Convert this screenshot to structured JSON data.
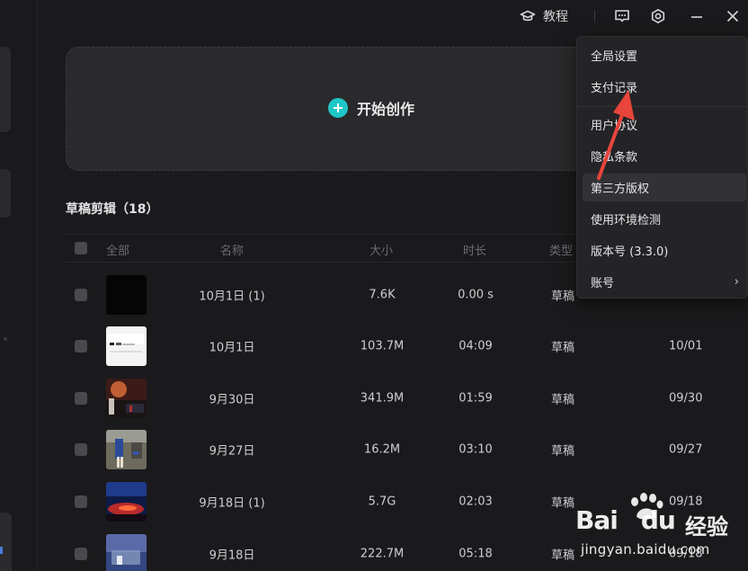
{
  "topbar": {
    "tutorial_label": "教程",
    "icons": [
      "graduation-cap-icon",
      "feedback-icon",
      "settings-hexagon-icon",
      "minimize-icon",
      "close-icon"
    ]
  },
  "create": {
    "label": "开始创作",
    "accent": "#1fc6c6"
  },
  "drafts": {
    "title": "草稿剪辑（18）",
    "columns": {
      "select_all": "全部",
      "name": "名称",
      "size": "大小",
      "duration": "时长",
      "type": "类型"
    },
    "rows": [
      {
        "name": "10月1日 (1)",
        "size": "7.6K",
        "duration": "0.00 s",
        "type": "草稿",
        "date": ""
      },
      {
        "name": "10月1日",
        "size": "103.7M",
        "duration": "04:09",
        "type": "草稿",
        "date": "10/01"
      },
      {
        "name": "9月30日",
        "size": "341.9M",
        "duration": "01:59",
        "type": "草稿",
        "date": "09/30"
      },
      {
        "name": "9月27日",
        "size": "16.2M",
        "duration": "03:10",
        "type": "草稿",
        "date": "09/27"
      },
      {
        "name": "9月18日 (1)",
        "size": "5.7G",
        "duration": "02:03",
        "type": "草稿",
        "date": "09/18"
      },
      {
        "name": "9月18日",
        "size": "222.7M",
        "duration": "05:18",
        "type": "草稿",
        "date": "09/18"
      }
    ]
  },
  "menu": {
    "items": [
      {
        "label": "全局设置"
      },
      {
        "label": "支付记录"
      },
      {
        "label": "用户协议"
      },
      {
        "label": "隐私条款"
      },
      {
        "label": "第三方版权"
      },
      {
        "label": "使用环境检测"
      },
      {
        "label": "版本号 (3.3.0)"
      },
      {
        "label": "账号",
        "arrow": "›"
      }
    ]
  },
  "annotation": {
    "color": "#e8453c"
  },
  "watermark": {
    "brand": "Bai",
    "brand2": "du",
    "suffix": "经验",
    "url": "jingyan.baidu.com"
  }
}
